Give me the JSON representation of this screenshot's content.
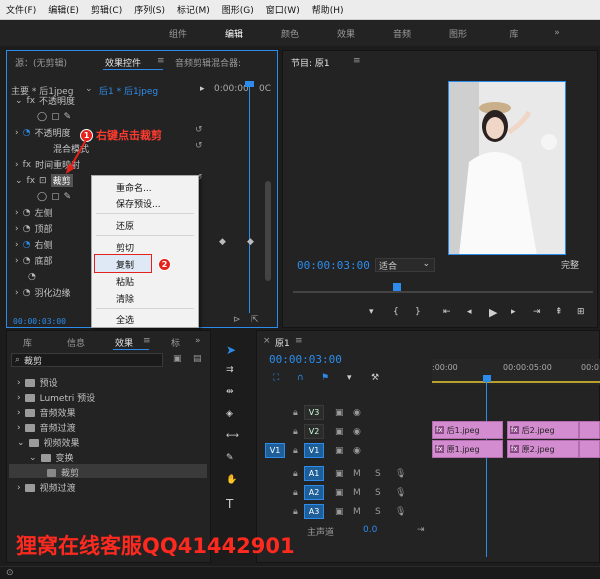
{
  "menubar": {
    "items": [
      "文件(F)",
      "编辑(E)",
      "剪辑(C)",
      "序列(S)",
      "标记(M)",
      "图形(G)",
      "窗口(W)",
      "帮助(H)"
    ]
  },
  "workspaces": {
    "tabs": [
      "组件",
      "编辑",
      "颜色",
      "效果",
      "音频",
      "图形",
      "库"
    ],
    "active": "编辑",
    "more": "»"
  },
  "source_panel": {
    "tabs": [
      "源：(无剪辑)",
      "效果控件",
      "音频剪辑混合器:"
    ],
    "master_label": "主要 * 后1jpeg",
    "clip_label": "后1 * 后1jpeg",
    "ruler_time": "0:00:00",
    "ruler_end": "0C",
    "rows": [
      "不透明度",
      "不透明度",
      "混合模式",
      "时间重映射",
      "裁剪",
      "左侧",
      "顶部",
      "右侧",
      "底部",
      "",
      "羽化边缘"
    ],
    "timecode": "00:00:03:00"
  },
  "context_menu": {
    "items": [
      "重命名...",
      "保存预设...",
      "还原",
      "剪切",
      "复制",
      "粘贴",
      "清除",
      "全选"
    ]
  },
  "annotation": {
    "badge1": "1",
    "label1": "右键点击裁剪",
    "badge2": "2"
  },
  "program_panel": {
    "title": "节目: 原1",
    "timecode": "00:00:03:00",
    "fit": "适合",
    "quality": "完整"
  },
  "effects_panel": {
    "tabs": [
      "库",
      "信息",
      "效果",
      "标"
    ],
    "search_value": "裁剪",
    "tree": [
      "预设",
      "Lumetri 预设",
      "音频效果",
      "音频过渡",
      "视频效果",
      "变换",
      "裁剪",
      "视频过渡"
    ]
  },
  "timeline": {
    "tab": "原1",
    "timecode": "00:00:03:00",
    "ruler_start": ":00:00",
    "ruler_mid": "00:00:05:00",
    "ruler_end": "00:0",
    "tracks": {
      "video": [
        "V3",
        "V2",
        "V1"
      ],
      "audio": [
        "A1",
        "A2",
        "A3"
      ],
      "source_v": "V1",
      "m": "M",
      "s": "S",
      "master": "主声道",
      "master_value": "0.0"
    },
    "clips_v2": [
      "后1.jpeg",
      "后2.jpeg"
    ],
    "clips_v1": [
      "原1.jpeg",
      "原2.jpeg"
    ],
    "fx": "fx"
  },
  "watermark": "狸窝在线客服QQ41442901",
  "colors": {
    "accent": "#2d8ceb",
    "clip": "#d48cd0",
    "annotation": "#e3221b"
  }
}
